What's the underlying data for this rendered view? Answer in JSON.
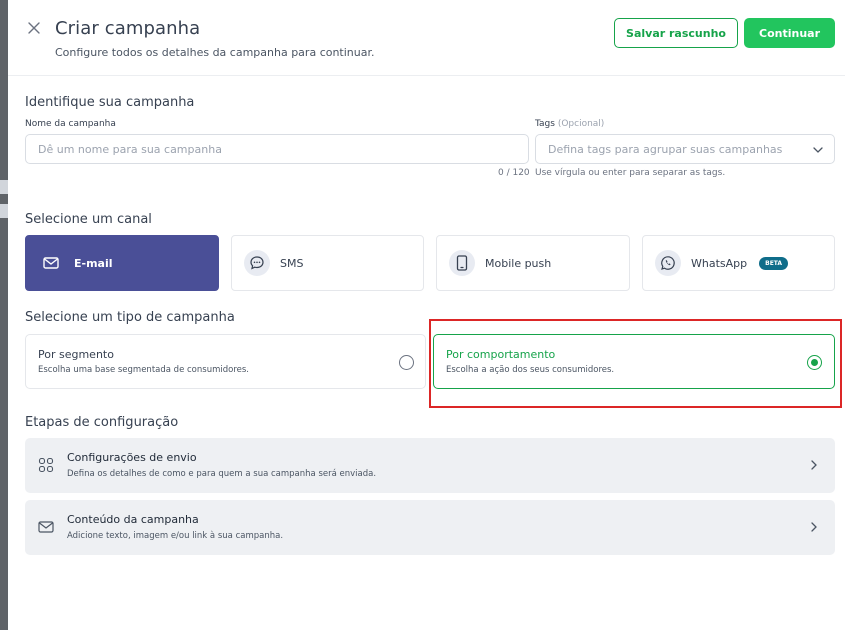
{
  "header": {
    "title": "Criar campanha",
    "subtitle": "Configure todos os detalhes da campanha para continuar.",
    "draft_label": "Salvar rascunho",
    "continue_label": "Continuar"
  },
  "identify": {
    "title": "Identifique sua campanha",
    "name_label": "Nome da campanha",
    "name_placeholder": "Dê um nome para sua campanha",
    "name_value": "",
    "name_counter": "0 / 120",
    "tags_label": "Tags",
    "tags_optional": "(Opcional)",
    "tags_placeholder": "Defina tags para agrupar suas campanhas",
    "tags_hint": "Use vírgula ou enter para separar as tags."
  },
  "channel": {
    "title": "Selecione um canal",
    "options": [
      {
        "label": "E-mail",
        "icon": "mail-icon",
        "selected": true
      },
      {
        "label": "SMS",
        "icon": "chat-bubble-icon",
        "selected": false
      },
      {
        "label": "Mobile push",
        "icon": "mobile-phone-icon",
        "selected": false
      },
      {
        "label": "WhatsApp",
        "icon": "whatsapp-icon",
        "selected": false,
        "badge": "BETA"
      }
    ]
  },
  "campaign_type": {
    "title": "Selecione um tipo de campanha",
    "options": [
      {
        "title": "Por segmento",
        "desc": "Escolha uma base segmentada de consumidores.",
        "selected": false
      },
      {
        "title": "Por comportamento",
        "desc": "Escolha a ação dos seus consumidores.",
        "selected": true
      }
    ]
  },
  "steps": {
    "title": "Etapas de configuração",
    "items": [
      {
        "title": "Configurações de envio",
        "desc": "Defina os detalhes de como e para quem a sua campanha será enviada.",
        "icon": "grid-icon"
      },
      {
        "title": "Conteúdo da campanha",
        "desc": "Adicione texto, imagem e/ou link à sua campanha.",
        "icon": "envelope-icon"
      }
    ]
  },
  "colors": {
    "accent_green": "#22c55e",
    "selected_channel": "#4a4f97",
    "highlight_red": "#dc2626",
    "beta_badge": "#0f6d8a"
  }
}
